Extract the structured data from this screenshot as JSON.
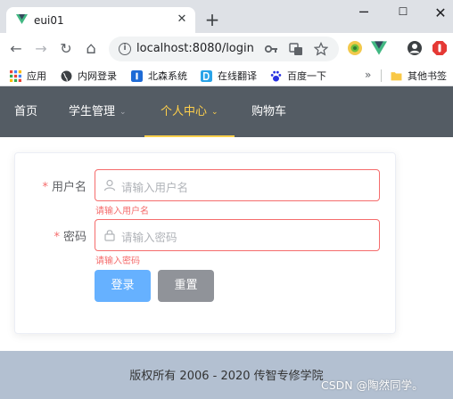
{
  "browser": {
    "tab_title": "eui01",
    "tab_close": "✕",
    "new_tab": "+",
    "window": {
      "minimize": "─",
      "maximize": "☐",
      "close": "✕"
    },
    "nav": {
      "back": "←",
      "forward": "→",
      "reload": "↻",
      "home": "⌂"
    },
    "url": "localhost:8080/login",
    "info_glyph": "i",
    "bookmarks": [
      {
        "label": "应用",
        "icon": "apps-grid-icon"
      },
      {
        "label": "内网登录",
        "icon": "globe-icon"
      },
      {
        "label": "北森系统",
        "icon": "beisen-icon"
      },
      {
        "label": "在线翻译",
        "icon": "translate-icon"
      },
      {
        "label": "百度一下",
        "icon": "baidu-icon"
      }
    ],
    "bookmarks_more": "»",
    "other_bookmarks": "其他书签"
  },
  "nav_menu": {
    "items": [
      {
        "label": "首页",
        "dropdown": false
      },
      {
        "label": "学生管理",
        "dropdown": true
      },
      {
        "label": "个人中心",
        "dropdown": true,
        "active": true
      },
      {
        "label": "购物车",
        "dropdown": false
      }
    ],
    "arrow": "⌄",
    "background": "#545c64",
    "active_color": "#ffd04b"
  },
  "login_form": {
    "username": {
      "label": "用户名",
      "required_mark": "*",
      "placeholder": "请输入用户名",
      "error": "请输入用户名",
      "icon": "user-icon"
    },
    "password": {
      "label": "密码",
      "required_mark": "*",
      "placeholder": "请输入密码",
      "error": "请输入密码",
      "icon": "lock-icon"
    },
    "login_button": "登录",
    "reset_button": "重置",
    "error_color": "#f56c6c"
  },
  "footer": {
    "text": "版权所有 2006 - 2020 传智专修学院",
    "watermark": "CSDN @陶然同学。"
  }
}
